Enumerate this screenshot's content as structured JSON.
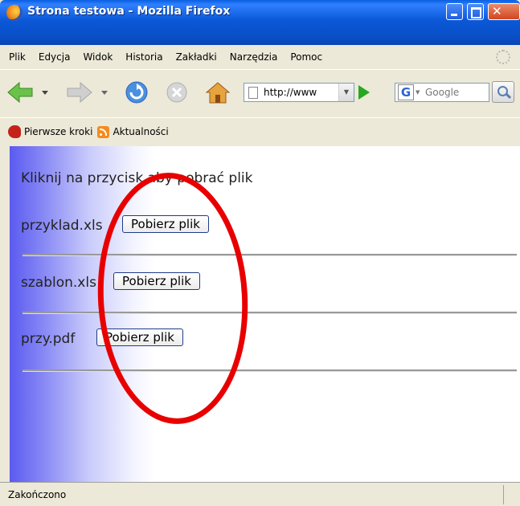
{
  "window": {
    "title": "Strona testowa - Mozilla Firefox"
  },
  "menu": {
    "items": [
      "Plik",
      "Edycja",
      "Widok",
      "Historia",
      "Zakładki",
      "Narzędzia",
      "Pomoc"
    ]
  },
  "toolbar": {
    "url": "http://www",
    "search_placeholder": "Google"
  },
  "bookmarks": {
    "items": [
      "Pierwsze kroki",
      "Aktualności"
    ]
  },
  "page": {
    "heading": "Kliknij na przycisk aby pobrać plik",
    "files": [
      {
        "name": "przyklad.xls",
        "button": "Pobierz plik"
      },
      {
        "name": "szablon.xls",
        "button": "Pobierz plik"
      },
      {
        "name": "przy.pdf",
        "button": "Pobierz plik"
      }
    ]
  },
  "status": {
    "text": "Zakończono"
  },
  "colors": {
    "annotation": "#e80000",
    "titlebar": "#0a5fe0"
  },
  "icons": [
    "firefox-logo-icon",
    "back-arrow-icon",
    "forward-arrow-icon",
    "reload-icon",
    "stop-icon",
    "home-icon",
    "go-icon",
    "google-icon",
    "search-icon",
    "rss-icon"
  ]
}
